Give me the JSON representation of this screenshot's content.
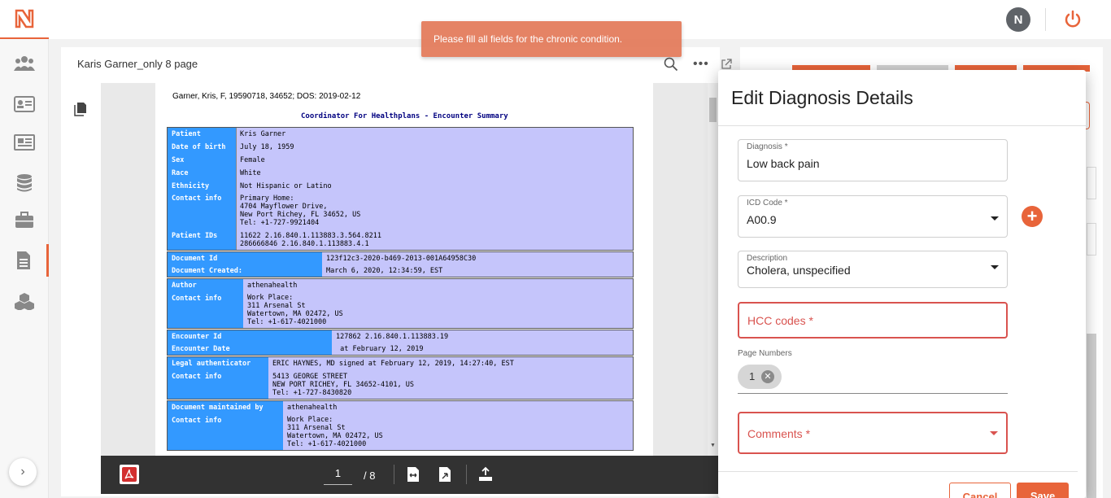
{
  "topbar": {
    "avatar_initial": "N"
  },
  "toast": {
    "message": "Please fill all fields for the chronic condition."
  },
  "viewer": {
    "doc_title": "Karis Garner_only 8 page",
    "pdf": {
      "header": "Garner, Kris, F, 19590718, 34652; DOS: 2019-02-12",
      "subtitle": "Coordinator For Healthplans - Encounter Summary",
      "patient_block": {
        "labels": [
          "Patient",
          "Date of birth",
          "Sex",
          "Race",
          "Ethnicity",
          "Contact info",
          "Patient IDs"
        ],
        "values": {
          "patient": "Kris Garner",
          "dob": "July 18, 1959",
          "sex": "Female",
          "race": "White",
          "ethnicity": "Not Hispanic or Latino",
          "contact": "Primary Home:\n4704 Mayflower Drive,\nNew Port Richey, FL 34652, US\nTel: +1-727-9921404",
          "ids": "11622 2.16.840.1.113883.3.564.8211\n286666846 2.16.840.1.113883.4.1"
        }
      },
      "document_block": {
        "labels": [
          "Document Id",
          "Document Created:"
        ],
        "values": [
          "123f12c3-2020-b469-2013-001A64958C30",
          "March 6, 2020, 12:34:59, EST"
        ]
      },
      "author_block": {
        "labels": [
          "Author",
          "Contact info"
        ],
        "values": [
          "athenahealth",
          "Work Place:\n311 Arsenal St\nWatertown, MA 02472, US\nTel: +1-617-4021000"
        ]
      },
      "encounter_block": {
        "labels": [
          "Encounter Id",
          "Encounter Date"
        ],
        "values": [
          "127862 2.16.840.1.113883.19",
          " at February 12, 2019"
        ]
      },
      "legal_block": {
        "labels": [
          "Legal authenticator",
          "Contact info"
        ],
        "values": [
          "ERIC HAYNES, MD signed at February 12, 2019, 14:27:40, EST",
          "5413 GEORGE STREET\nNEW PORT RICHEY, FL 34652-4101, US\nTel: +1-727-8430820"
        ]
      },
      "maintained_block": {
        "labels": [
          "Document maintained by",
          "Contact info"
        ],
        "values": [
          "athenahealth",
          "Work Place:\n311 Arsenal St\nWatertown, MA 02472, US\nTel: +1-617-4021000"
        ]
      }
    },
    "toolbar": {
      "current_page": "1",
      "total_pages": "/ 8"
    }
  },
  "modal": {
    "title": "Edit Diagnosis Details",
    "diagnosis": {
      "label": "Diagnosis *",
      "value": "Low back pain"
    },
    "icd": {
      "label": "ICD Code *",
      "value": "A00.9"
    },
    "description": {
      "label": "Description",
      "value": "Cholera, unspecified"
    },
    "hcc": {
      "placeholder": "HCC codes",
      "required_mark": "*"
    },
    "page_numbers": {
      "label": "Page Numbers",
      "chips": [
        "1"
      ]
    },
    "comments": {
      "placeholder": "Comments",
      "required_mark": "*"
    },
    "buttons": {
      "cancel": "Cancel",
      "save": "Save"
    }
  },
  "colors": {
    "accent": "#e8643a",
    "error": "#d9534f",
    "pdf_label_bg": "#3399ff",
    "pdf_value_bg": "#c5c5fb"
  }
}
